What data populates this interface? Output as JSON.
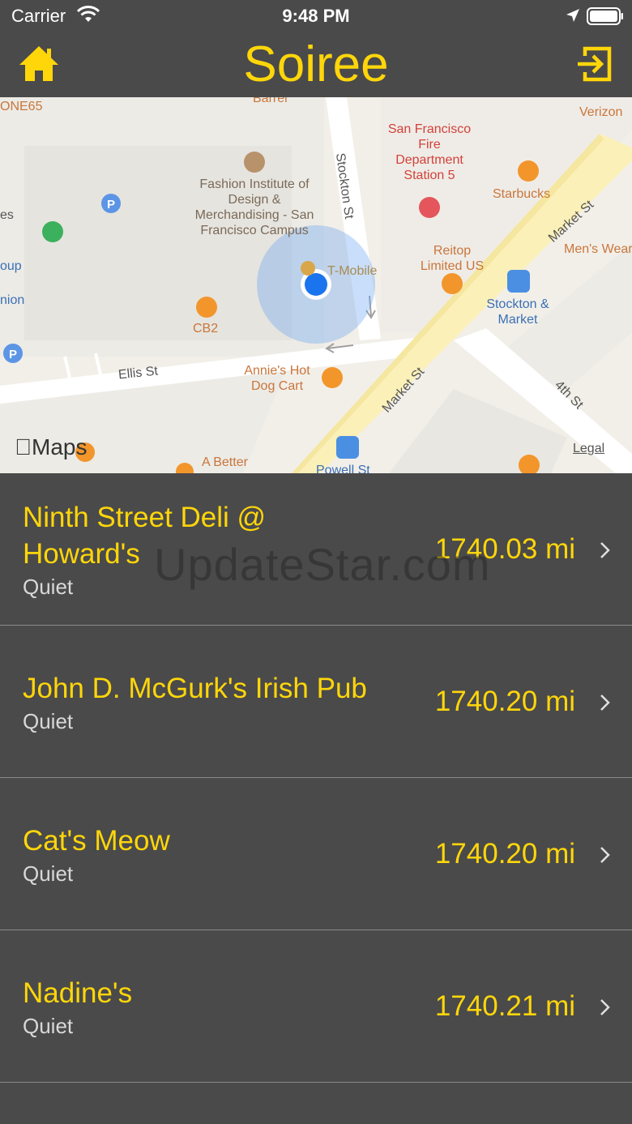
{
  "status_bar": {
    "carrier": "Carrier",
    "time": "9:48 PM"
  },
  "nav": {
    "title": "Soiree",
    "home_icon": "home-icon",
    "logout_icon": "logout-icon",
    "accent_color": "#ffd60a"
  },
  "map": {
    "labels": {
      "zone": "ONE65",
      "barrel": "Barrel",
      "fidm": "Fashion Institute of Design & Merchandising - San Francisco Campus",
      "stockton_st": "Stockton St",
      "sf_fire": "San Francisco Fire Department Station 5",
      "starbucks": "Starbucks",
      "verizon": "Verizon",
      "market_st_top": "Market St",
      "reitop": "Reitop Limited US",
      "men_wearhouse": "Men's Wearhouse",
      "tmobile": "T-Mobile",
      "cb2": "CB2",
      "stockton_market": "Stockton & Market",
      "ellis_st": "Ellis St",
      "annies": "Annie's Hot Dog Cart",
      "market_st_bottom": "Market St",
      "fourth_st": "4th St",
      "a_better": "A Better",
      "powell_st": "Powell St",
      "left_es": "es",
      "left_oup": "oup",
      "left_nion": "nion"
    },
    "maps_logo": "Maps",
    "legal": "Legal"
  },
  "venues": [
    {
      "name": "Ninth Street Deli @ Howard's",
      "status": "Quiet",
      "distance": "1740.03 mi"
    },
    {
      "name": "John D. McGurk's Irish Pub",
      "status": "Quiet",
      "distance": "1740.20 mi"
    },
    {
      "name": "Cat's Meow",
      "status": "Quiet",
      "distance": "1740.20 mi"
    },
    {
      "name": "Nadine's",
      "status": "Quiet",
      "distance": "1740.21 mi"
    }
  ],
  "watermark": "UpdateStar.com"
}
